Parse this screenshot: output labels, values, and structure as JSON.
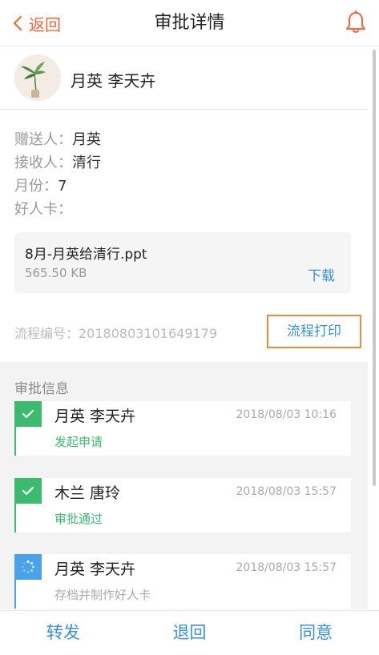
{
  "header": {
    "back_label": "返回",
    "title": "审批详情"
  },
  "user": {
    "name": "月英 李天卉"
  },
  "info": [
    {
      "key": "赠送人：",
      "value": "月英"
    },
    {
      "key": "接收人：",
      "value": "清行"
    },
    {
      "key": "月份：",
      "value": "7"
    },
    {
      "key": "好人卡：",
      "value": ""
    }
  ],
  "attachment": {
    "file_name": "8月-月英给清行.ppt",
    "file_size": "565.50 KB",
    "download_label": "下载"
  },
  "process": {
    "number_text": "流程编号：20180803101649179",
    "print_label": "流程打印"
  },
  "approval": {
    "title": "审批信息",
    "items": [
      {
        "name": "月英 李天卉",
        "time": "2018/08/03 10:16",
        "status": "发起申请",
        "state": "done"
      },
      {
        "name": "木兰 唐玲",
        "time": "2018/08/03 15:57",
        "status": "审批通过",
        "state": "done"
      },
      {
        "name": "月英 李天卉",
        "time": "2018/08/03 15:57",
        "status": "存档并制作好人卡",
        "state": "pending"
      }
    ]
  },
  "footer": {
    "forward_label": "转发",
    "reject_label": "退回",
    "approve_label": "同意"
  },
  "colors": {
    "accent": "#f0683c",
    "link": "#3b8fd9",
    "success": "#3cbb6f",
    "pending": "#4aa3e8",
    "highlight_border": "#f08a3c"
  }
}
